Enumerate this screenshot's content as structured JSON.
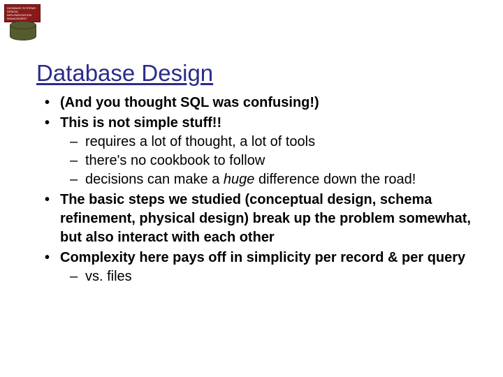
{
  "logo": {
    "line1": "DATABASE SYSTEMS",
    "line2": "DESIGN, IMPLEMENTATION",
    "line3": "MANAGEMENT"
  },
  "slide": {
    "title": "Database Design",
    "bullets": {
      "b1": "(And you thought SQL was confusing!)",
      "b2": "This is not simple stuff!!",
      "b2_subs": {
        "s1": "requires a lot of thought, a lot of tools",
        "s2": "there's no cookbook to follow",
        "s3_pre": "decisions can make a ",
        "s3_em": "huge",
        "s3_post": " difference down the road!"
      },
      "b3": "The basic steps we studied (conceptual design, schema refinement, physical design) break up the problem somewhat, but also interact with each other",
      "b4": "Complexity here pays off in simplicity per record & per query",
      "b4_subs": {
        "s1": "vs. files"
      }
    }
  }
}
